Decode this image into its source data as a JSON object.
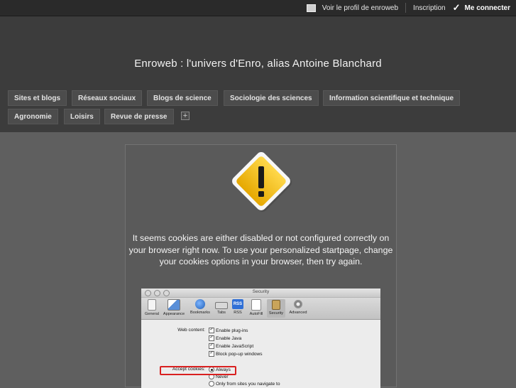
{
  "topbar": {
    "profile_link": "Voir le profil de enroweb",
    "signup_link": "Inscription",
    "login_link": "Me connecter"
  },
  "header": {
    "site_title": "Enroweb : l'univers d'Enro, alias Antoine Blanchard"
  },
  "nav": {
    "tabs": [
      {
        "label": "Sites et blogs"
      },
      {
        "label": "Réseaux sociaux"
      },
      {
        "label": "Blogs de science"
      },
      {
        "label": "Sociologie des sciences"
      },
      {
        "label": "Information scientifique et technique"
      },
      {
        "label": "Agronomie"
      },
      {
        "label": "Loisirs"
      },
      {
        "label": "Revue de presse"
      }
    ],
    "add_label": "+"
  },
  "main": {
    "message": "It seems cookies are either disabled or not configured correctly on your browser right now. To use your personalized startpage, change your cookies options in your browser, then try again.",
    "warning_icon": "warning-triangle-icon",
    "warning_color": "#f5c400"
  },
  "prefs_screenshot": {
    "window_title": "Security",
    "toolbar": [
      "General",
      "Appearance",
      "Bookmarks",
      "Tabs",
      "RSS",
      "AutoFill",
      "Security",
      "Advanced"
    ],
    "rss_badge": "RSS",
    "web_content_label": "Web content:",
    "web_content_options": [
      "Enable plug-ins",
      "Enable Java",
      "Enable JavaScript",
      "Block pop-up windows"
    ],
    "accept_cookies_label": "Accept cookies:",
    "cookie_options": [
      "Always",
      "Never",
      "Only from sites you navigate to"
    ],
    "highlight_color": "#d92020"
  }
}
